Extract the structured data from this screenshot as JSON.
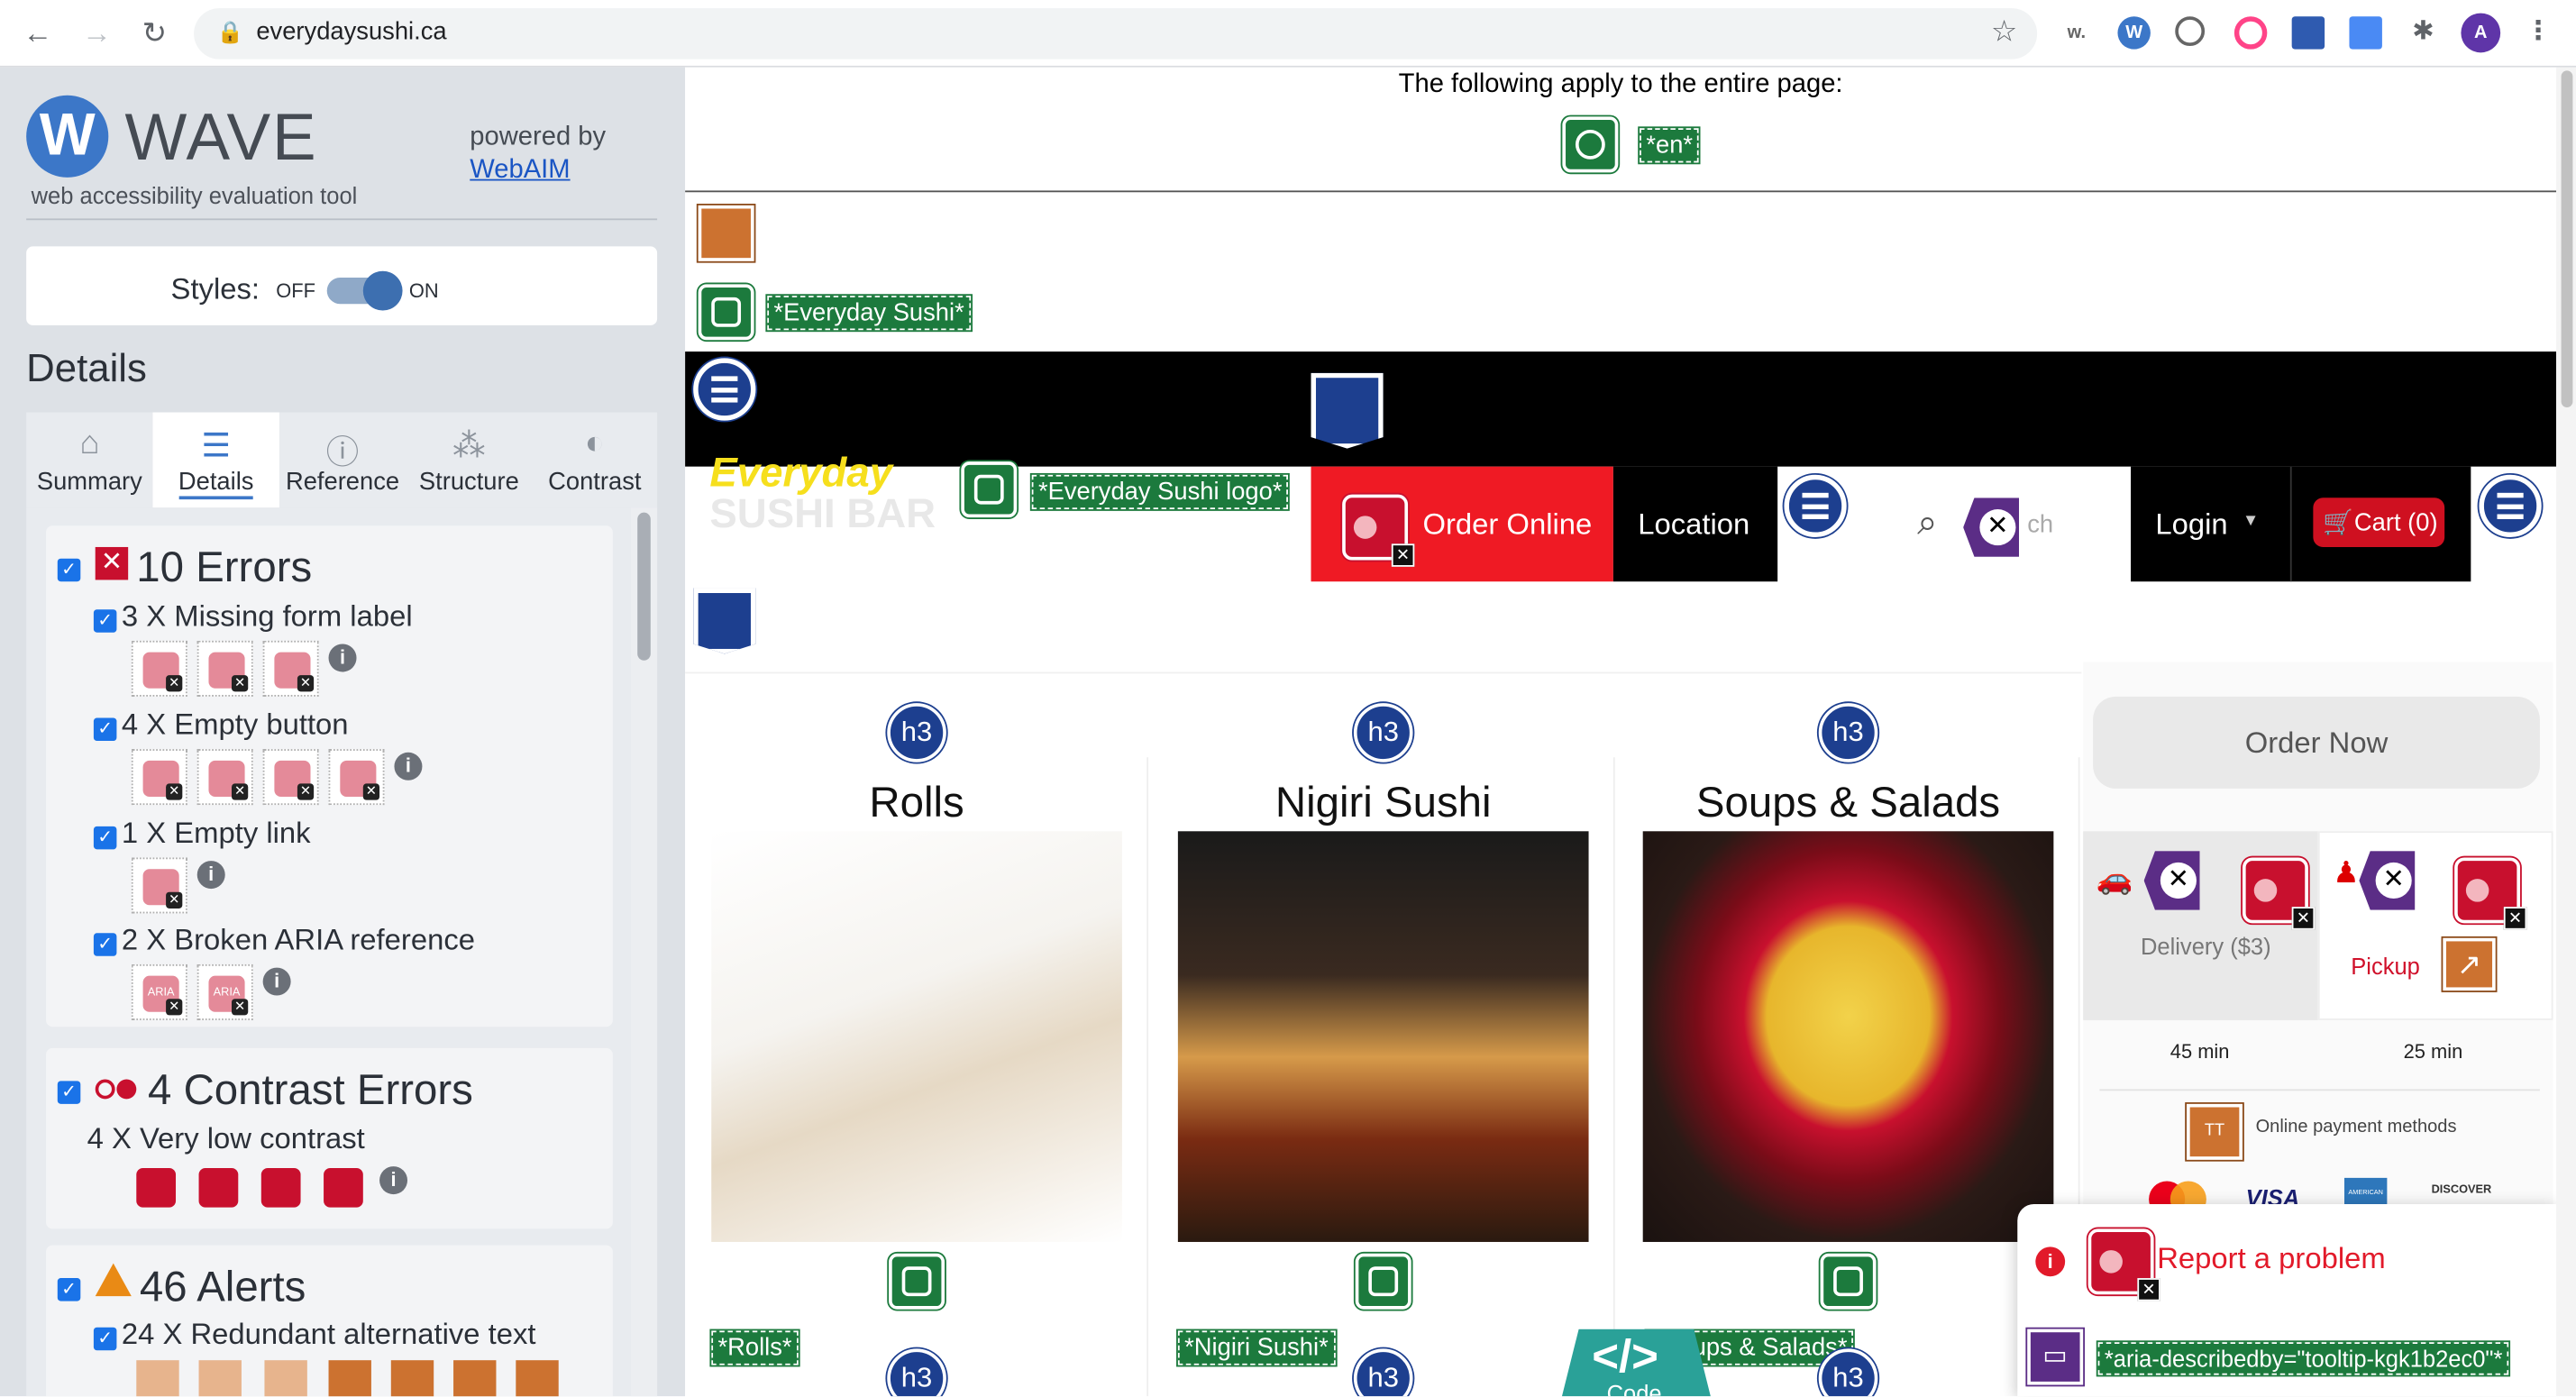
{
  "browser": {
    "url": "everydaysushi.ca",
    "extensions": [
      "w.",
      "W",
      "A"
    ]
  },
  "wave": {
    "logo_letter": "W",
    "logo_text": "WAVE",
    "tagline": "web accessibility evaluation tool",
    "powered_by": "powered by",
    "webaim": "WebAIM",
    "styles_label": "Styles:",
    "styles_off": "OFF",
    "styles_on": "ON",
    "details_heading": "Details",
    "tabs": [
      "Summary",
      "Details",
      "Reference",
      "Structure",
      "Contrast"
    ],
    "errors": {
      "title": "10 Errors",
      "items": [
        {
          "label": "3 X Missing form label",
          "count": 3
        },
        {
          "label": "4 X Empty button",
          "count": 4
        },
        {
          "label": "1 X Empty link",
          "count": 1
        },
        {
          "label": "2 X Broken ARIA reference",
          "count": 2
        }
      ]
    },
    "contrast": {
      "title": "4 Contrast Errors",
      "item": "4 X Very low contrast"
    },
    "alerts": {
      "title": "46 Alerts",
      "item": "24 X Redundant alternative text"
    },
    "aria_icon_text": "ARIA",
    "info_glyph": "i"
  },
  "page": {
    "entire_page_note": "The following apply to the entire page:",
    "lang_label": "*en*",
    "alt_label_site": "*Everyday Sushi*",
    "logo_text_line1": "Everyday",
    "logo_text_line2": "SUSHI BAR",
    "alt_label_logo": "*Everyday Sushi logo*",
    "nav": {
      "order_online": "Order Online",
      "location": "Location",
      "search_fragment": "ch",
      "login": "Login",
      "cart": "Cart (0)"
    },
    "h3_badge": "h3",
    "categories": [
      {
        "title": "Rolls",
        "alt": "*Rolls*"
      },
      {
        "title": "Nigiri Sushi",
        "alt": "*Nigiri Sushi*"
      },
      {
        "title": "Soups & Salads",
        "alt": "*Soups & Salads*"
      }
    ],
    "order_panel": {
      "order_now": "Order Now",
      "delivery": "Delivery ($3)",
      "pickup": "Pickup",
      "delivery_time": "45 min",
      "pickup_time": "25 min",
      "payment_label": "Online payment methods",
      "payment_icon_text": "TT",
      "cards": [
        "VISA",
        "AMERICAN",
        "DISCOVER"
      ]
    },
    "report_problem": "Report a problem",
    "aria_label": "*aria-describedby=\"tooltip-kgk1b2ec0\"*",
    "code_label": "Code",
    "code_glyph": "</>"
  }
}
